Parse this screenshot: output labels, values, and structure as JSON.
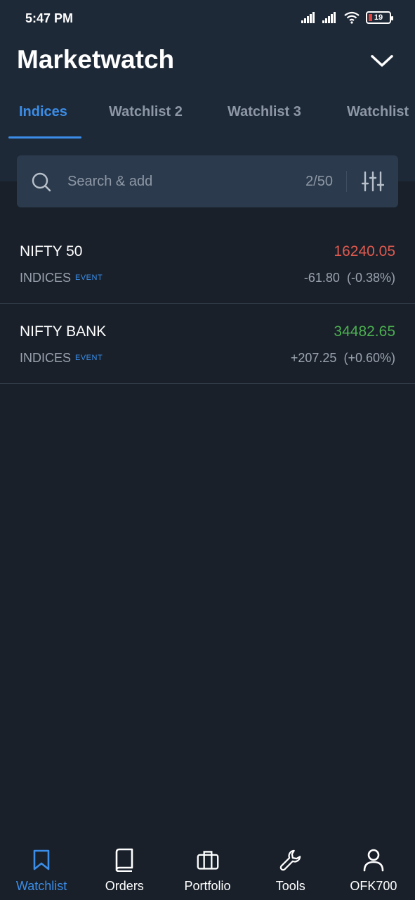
{
  "status_bar": {
    "time": "5:47 PM",
    "battery": "19"
  },
  "header": {
    "title": "Marketwatch"
  },
  "tabs": [
    {
      "label": "Indices",
      "active": true
    },
    {
      "label": "Watchlist 2",
      "active": false
    },
    {
      "label": "Watchlist 3",
      "active": false
    },
    {
      "label": "Watchlist",
      "active": false
    }
  ],
  "search": {
    "placeholder": "Search & add",
    "count": "2/50"
  },
  "instruments": [
    {
      "symbol": "NIFTY 50",
      "price": "16240.05",
      "direction": "down",
      "exchange": "INDICES",
      "tag": "EVENT",
      "change": "-61.80",
      "change_pct": "(-0.38%)"
    },
    {
      "symbol": "NIFTY BANK",
      "price": "34482.65",
      "direction": "up",
      "exchange": "INDICES",
      "tag": "EVENT",
      "change": "+207.25",
      "change_pct": "(+0.60%)"
    }
  ],
  "bottom_nav": [
    {
      "label": "Watchlist",
      "icon": "bookmark-icon",
      "active": true
    },
    {
      "label": "Orders",
      "icon": "book-icon",
      "active": false
    },
    {
      "label": "Portfolio",
      "icon": "briefcase-icon",
      "active": false
    },
    {
      "label": "Tools",
      "icon": "wrench-icon",
      "active": false
    },
    {
      "label": "OFK700",
      "icon": "user-icon",
      "active": false
    }
  ],
  "colors": {
    "accent": "#3b8de8",
    "negative": "#e05a4f",
    "positive": "#4caf50",
    "background": "#19202a",
    "header_bg": "#1e2937"
  }
}
